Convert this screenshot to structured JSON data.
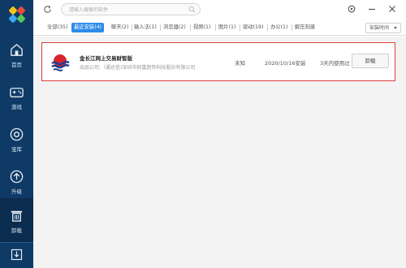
{
  "sidebar": {
    "items": [
      {
        "label": "首页",
        "icon": "home-icon"
      },
      {
        "label": "游戏",
        "icon": "gamepad-icon"
      },
      {
        "label": "宝库",
        "icon": "treasure-icon"
      },
      {
        "label": "升级",
        "icon": "upgrade-icon"
      },
      {
        "label": "卸载",
        "icon": "trash-icon"
      }
    ],
    "active_index": 4
  },
  "search": {
    "placeholder": "请输入搜索的软件"
  },
  "tabs": [
    {
      "label": "全部(35)"
    },
    {
      "label": "最近安装(4)"
    },
    {
      "label": "聊天(2)"
    },
    {
      "label": "输入法(1)"
    },
    {
      "label": "浏览器(2)"
    },
    {
      "label": "视频(1)"
    },
    {
      "label": "图片(1)"
    },
    {
      "label": "驱动(19)"
    },
    {
      "label": "办公(1)"
    },
    {
      "label": "解压刻录"
    }
  ],
  "active_tab": 1,
  "sort": {
    "label": "安装时间"
  },
  "apps": [
    {
      "name": "金长江网上交易财智版",
      "publisher": "出品公司:（通达信)深圳市财富趋势科技股份有限公司",
      "size": "未知",
      "install_date": "2020/10/16安装",
      "usage": "3天内使用过",
      "action": "卸载"
    }
  ],
  "colors": {
    "sidebar": "#0f3a66",
    "accent": "#2b8be8",
    "highlight": "#e23b3b"
  }
}
